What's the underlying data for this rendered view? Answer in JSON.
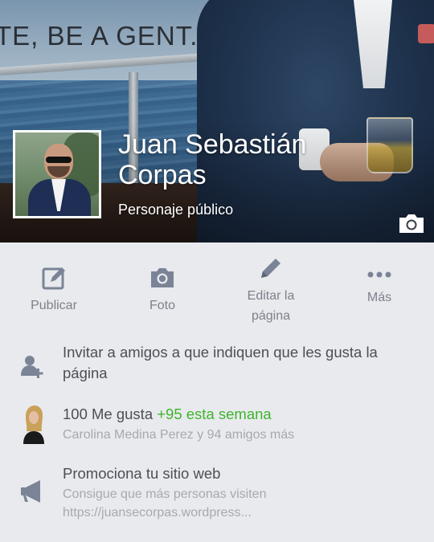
{
  "cover": {
    "overlay_text": "TE, BE A GENT."
  },
  "profile": {
    "name": "Juan Sebastián Corpas",
    "category": "Personaje público"
  },
  "actions": [
    {
      "label": "Publicar",
      "icon": "compose-icon"
    },
    {
      "label": "Foto",
      "icon": "camera-icon"
    },
    {
      "label": "Editar la página",
      "icon": "pencil-icon"
    },
    {
      "label": "Más",
      "icon": "more-dots-icon"
    }
  ],
  "invite": {
    "text": "Invitar a amigos a que indiquen que les gusta la página",
    "icon": "add-friend-icon"
  },
  "likes": {
    "count_text": "100 Me gusta",
    "weekly_text": "+95 esta semana",
    "friends_text": "Carolina Medina Perez y 94 amigos más"
  },
  "promote": {
    "title": "Promociona tu sitio web",
    "subtitle_line1": "Consigue que más personas visiten",
    "subtitle_line2": "https://juansecorpas.wordpress...",
    "icon": "megaphone-icon"
  },
  "colors": {
    "background": "#e9eaee",
    "icon_gray": "#7b8496",
    "text": "#4b4f56",
    "muted": "#a7a9b0",
    "accent_green": "#3fb52d"
  }
}
